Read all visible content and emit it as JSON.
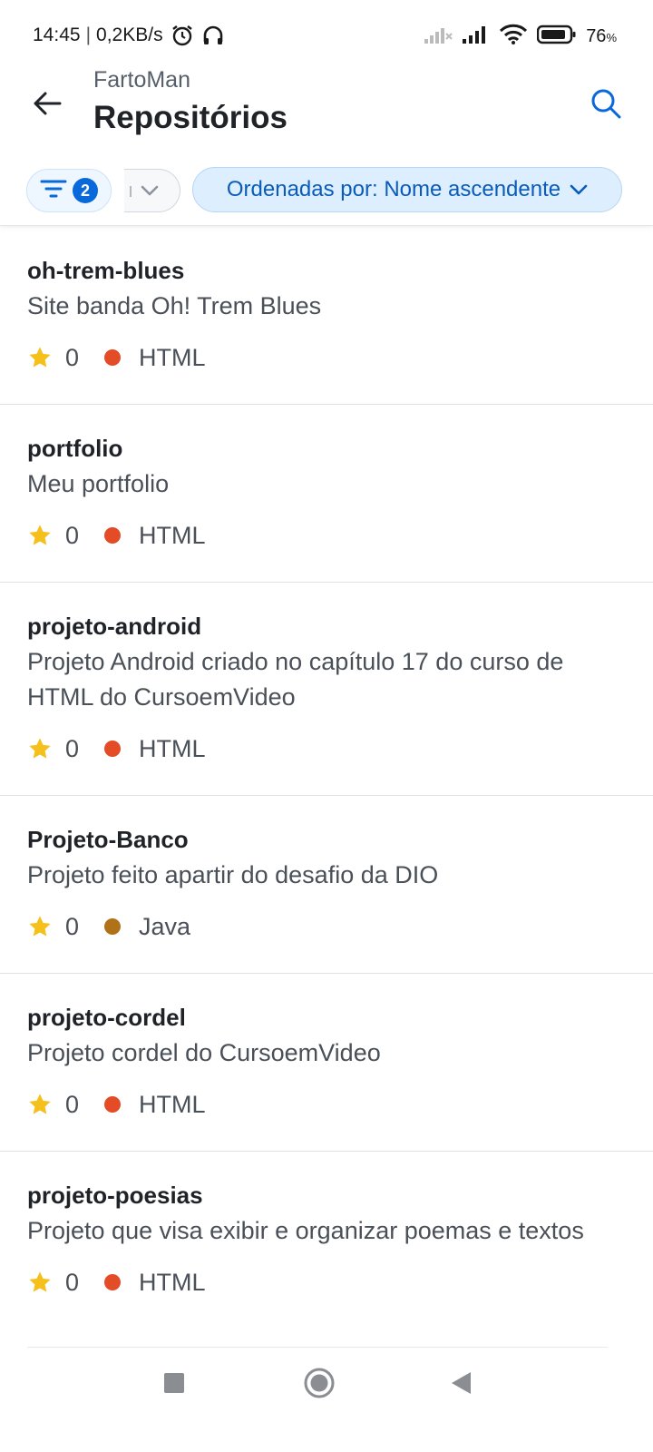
{
  "status_bar": {
    "time": "14:45",
    "net_speed": "0,2KB/s",
    "battery_percent": "76",
    "battery_suffix": "%",
    "icons": [
      "alarm-icon",
      "headphones-icon",
      "signal-off-icon",
      "signal-icon",
      "wifi-icon",
      "battery-icon"
    ]
  },
  "header": {
    "owner": "FartoMan",
    "title": "Repositórios",
    "icons": {
      "back": "arrow-left-icon",
      "search": "search-icon"
    }
  },
  "filters": {
    "filter_count": "2",
    "partial_chip_text": "ı",
    "sort_label": "Ordenadas por: Nome ascendente"
  },
  "colors": {
    "accent": "#0969da",
    "star": "#f5c01b",
    "lang_html": "#e34c26",
    "lang_java": "#b07219"
  },
  "repos": [
    {
      "name": "oh-trem-blues",
      "description": "Site banda Oh! Trem Blues",
      "stars": "0",
      "language": "HTML",
      "lang_color": "#e34c26"
    },
    {
      "name": "portfolio",
      "description": "Meu portfolio",
      "stars": "0",
      "language": "HTML",
      "lang_color": "#e34c26"
    },
    {
      "name": "projeto-android",
      "description": "Projeto Android criado no capítulo 17 do curso de HTML do CursoemVideo",
      "stars": "0",
      "language": "HTML",
      "lang_color": "#e34c26"
    },
    {
      "name": "Projeto-Banco",
      "description": "Projeto feito apartir do desafio da DIO",
      "stars": "0",
      "language": "Java",
      "lang_color": "#b07219"
    },
    {
      "name": "projeto-cordel",
      "description": "Projeto cordel do CursoemVideo",
      "stars": "0",
      "language": "HTML",
      "lang_color": "#e34c26"
    },
    {
      "name": "projeto-poesias",
      "description": "Projeto que visa exibir e organizar poemas e textos",
      "stars": "0",
      "language": "HTML",
      "lang_color": "#e34c26"
    }
  ],
  "nav_bar": {
    "icons": [
      "recents-square-icon",
      "home-circle-icon",
      "back-triangle-icon"
    ]
  }
}
